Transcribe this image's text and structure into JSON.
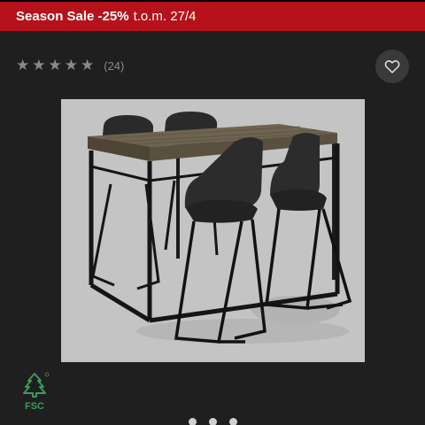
{
  "banner": {
    "sale_label": "Season Sale -25%",
    "period": "t.o.m. 27/4",
    "color": "#b5121b"
  },
  "rating": {
    "stars": 5,
    "count_text": "(24)"
  },
  "favorite": {
    "icon": "heart-icon"
  },
  "product_image": {
    "alt": "Bar table with four black bar stools"
  },
  "certification": {
    "icon": "fsc-logo",
    "label": "FSC"
  },
  "pager": {
    "dots": 3
  }
}
